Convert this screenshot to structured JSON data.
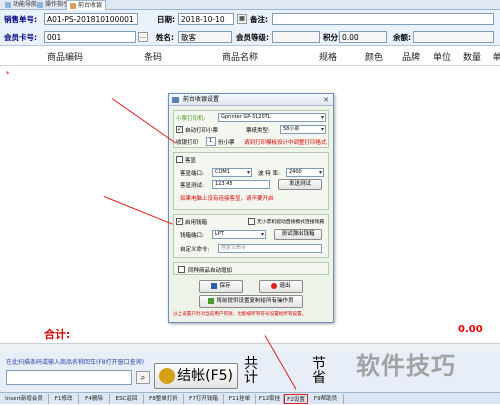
{
  "tabs": [
    {
      "label": "功能导航"
    },
    {
      "label": "操作指引"
    },
    {
      "label": "前台收银"
    }
  ],
  "header": {
    "sale_no_label": "销售单号:",
    "sale_no_value": "A01-PS-201810100001",
    "date_label": "日期:",
    "date_value": "2018-10-10",
    "note_label": "备注:",
    "note_value": "",
    "member_card_label": "会员卡号:",
    "member_card_value": "001",
    "name_label": "姓名:",
    "name_value": "散客",
    "member_level_label": "会员等级:",
    "member_level_value": "",
    "points_label": "积分:",
    "points_value": "0.00",
    "balance_label": "余额:",
    "balance_value": ""
  },
  "grid": {
    "columns": [
      "商品编码",
      "条码",
      "商品名称",
      "规格",
      "颜色",
      "品牌",
      "单位",
      "数量",
      "单"
    ],
    "empty_marker": "*"
  },
  "footer": {
    "total_label": "合计:",
    "total_value": "0.00",
    "hint_text": "在此扫描条码或输入商品名称回车(F8打开窗口查询)",
    "barcode_value": "",
    "checkout_label": "结帐(F5)",
    "sum_label_1": "共",
    "sum_label_2": "计",
    "save_label_1": "节",
    "save_label_2": "省"
  },
  "function_keys": [
    "Insert新增会员",
    "F1修改",
    "F4删除",
    "ESC返回",
    "F8整单打折",
    "F7打开钱箱",
    "F11挂单",
    "F12取挂",
    "F2设置",
    "F9帮助员"
  ],
  "dialog": {
    "title": "前台收银设置",
    "printer_label": "小票打印机:",
    "printer_value": "Gprinter  GP-3120TL",
    "auto_print_label": "自动打印小票",
    "auto_print_checked": true,
    "paper_label": "票纸类型:",
    "paper_value": "58小票",
    "copies_label": "收银打印",
    "copies_value": "1",
    "copies_unit": "份小票",
    "template_note": "请到打印模板设计中调整打印格式",
    "display_group_label": "客显",
    "display_enabled": false,
    "port_label": "客显端口:",
    "port_value": "COM1",
    "baud_label": "波 特 率:",
    "baud_value": "2400",
    "test_label": "客显测试:",
    "test_value": "123.45",
    "test_button": "发送测试",
    "display_note": "如果电脑上没有连接客显，请不要开启",
    "drawer_label": "启用钱箱",
    "drawer_checked": true,
    "drawer_mode_label": "无小票机驱动直接模式连接钱箱",
    "drawer_mode_checked": false,
    "drawer_port_label": "钱箱端口:",
    "drawer_port_value": "LPT",
    "drawer_test_button": "测试弹出钱箱",
    "custom_cmd_label": "自定义命令:",
    "custom_cmd_placeholder": "自定义命令",
    "merge_label": "同种商品自动增加",
    "merge_checked": false,
    "save_button": "保存",
    "exit_button": "退出",
    "apply_all_button": "将前提供设置复制给所有操作员",
    "bottom_note": "以上设置只针对当前用户有效，也能被所有符号设置给所有设置。",
    "colors": {
      "accent_green": "#4c9a2a",
      "warning_red": "#e00000"
    }
  },
  "watermark": "软件技巧"
}
